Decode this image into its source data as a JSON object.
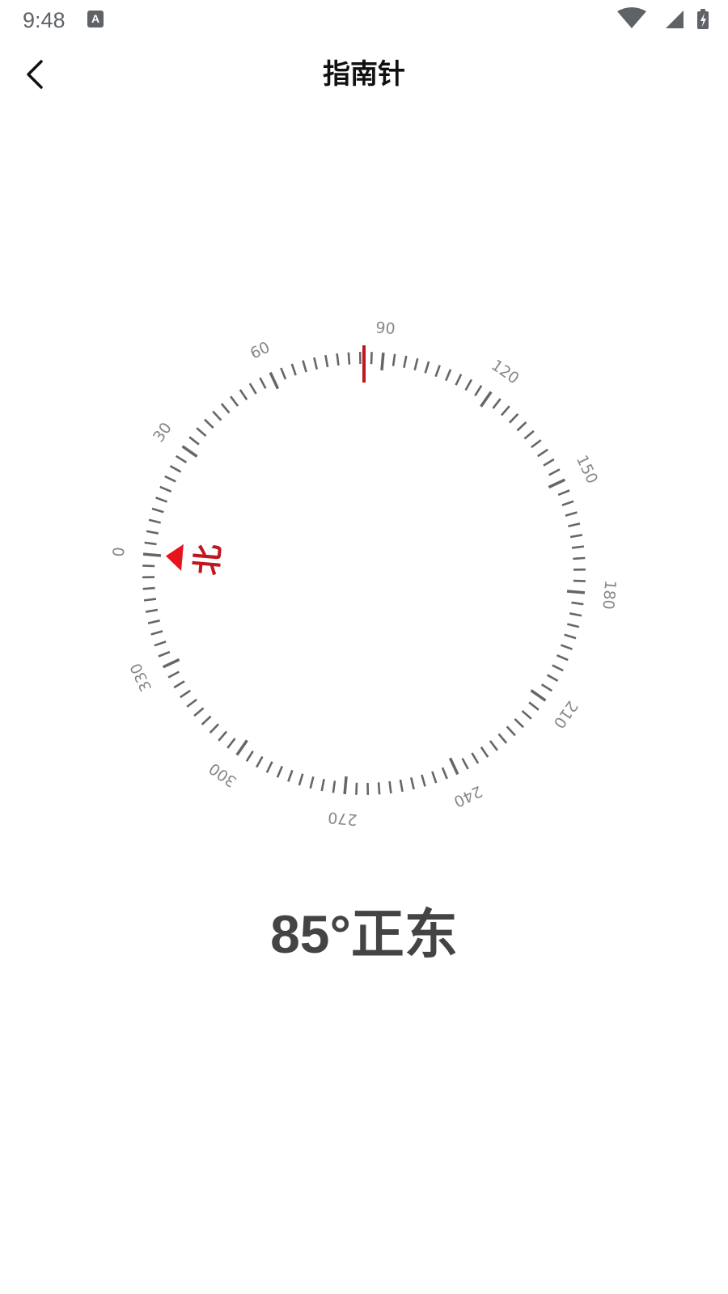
{
  "status_bar": {
    "time": "9:48",
    "app_icon_letter": "A",
    "icons": [
      "wifi-icon",
      "cell-signal-icon",
      "battery-charging-icon"
    ]
  },
  "app_bar": {
    "title": "指南针",
    "back_icon": "chevron-left-icon"
  },
  "compass": {
    "heading_deg": 85,
    "dial_labels": [
      "0",
      "30",
      "60",
      "90",
      "120",
      "150",
      "180",
      "210",
      "240",
      "270",
      "300",
      "330"
    ],
    "north_label": "北",
    "tick_color": "#666666",
    "label_color": "#888888",
    "north_color": "#c0171f",
    "indicator_color": "#c0171f"
  },
  "readout": {
    "degree": "85°",
    "direction": "正东",
    "color": "#444444"
  }
}
